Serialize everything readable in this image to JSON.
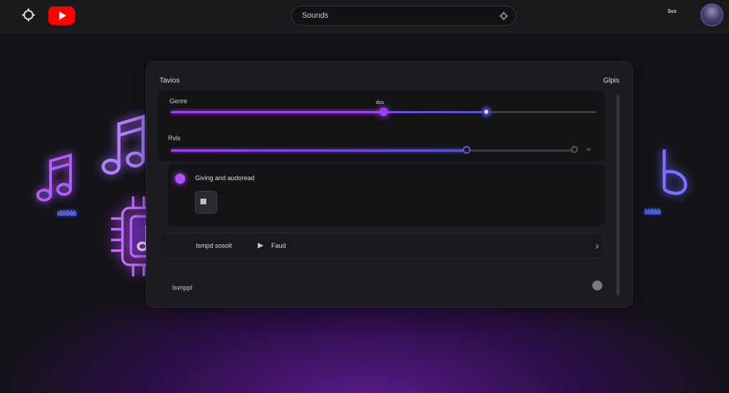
{
  "header": {
    "search_text": "Sounds",
    "right_text": "Sss",
    "icons": {
      "menu": "settings-icon",
      "logo": "youtube-logo",
      "search": "search-icon",
      "avatar": "avatar"
    }
  },
  "panel": {
    "title": "Tavios",
    "right_label": "Glpis",
    "card1": {
      "label_a": "Genre",
      "label_b": "Rvls",
      "tooltip": "dos",
      "slider1_purple_fraction": 0.5,
      "slider1_blue_fraction": 0.74,
      "slider2_fraction": 0.73,
      "slider2_end_mark": "‹›"
    },
    "card2": {
      "label": "Giving and audoread",
      "chip_text": "llll"
    },
    "row3": {
      "label": "Ismpd sosoit",
      "value": "Faud",
      "chevron": "›"
    },
    "row4": {
      "label": "lsvnppl"
    }
  },
  "decorations": {
    "wave_left": "ıılılıllılılı",
    "wave_right": "lılıllılılı"
  },
  "colors": {
    "accent_purple": "#b04cff",
    "accent_blue": "#5a5cff",
    "youtube_red": "#ff0000"
  }
}
